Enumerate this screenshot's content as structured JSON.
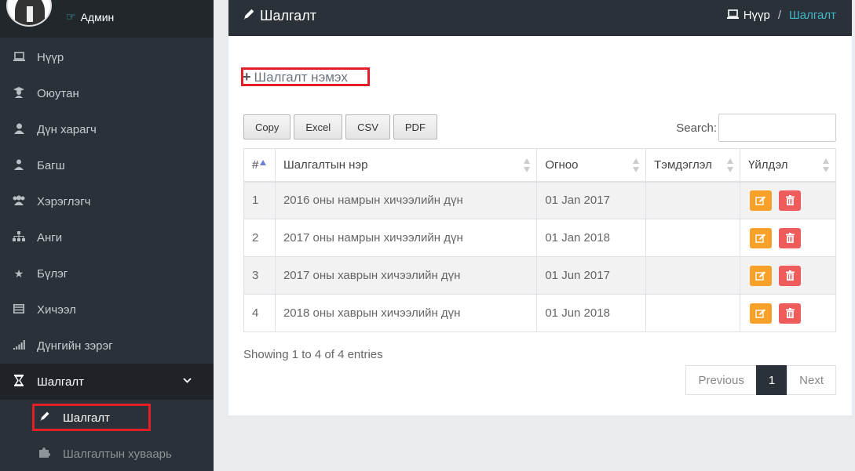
{
  "user": {
    "name": "Админ"
  },
  "sidebar": {
    "items": [
      {
        "label": "Нүүр",
        "icon": "laptop-icon"
      },
      {
        "label": "Оюутан",
        "icon": "graduate-icon"
      },
      {
        "label": "Дүн харагч",
        "icon": "user-icon"
      },
      {
        "label": "Багш",
        "icon": "teacher-icon"
      },
      {
        "label": "Хэрэглэгч",
        "icon": "users-icon"
      },
      {
        "label": "Анги",
        "icon": "sitemap-icon"
      },
      {
        "label": "Бүлэг",
        "icon": "star-icon"
      },
      {
        "label": "Хичээл",
        "icon": "book-icon"
      },
      {
        "label": "Дүнгийн зэрэг",
        "icon": "signal-icon"
      },
      {
        "label": "Шалгалт",
        "icon": "hourglass-icon"
      }
    ],
    "submenu": [
      {
        "label": "Шалгалт",
        "icon": "pencil-icon"
      },
      {
        "label": "Шалгалтын хуваарь",
        "icon": "puzzle-icon"
      }
    ]
  },
  "header": {
    "title": "Шалгалт",
    "breadcrumb_home": "Нүүр",
    "breadcrumb_sep": "/",
    "breadcrumb_current": "Шалгалт"
  },
  "main": {
    "add_label": "Шалгалт нэмэх",
    "buttons": [
      "Copy",
      "Excel",
      "CSV",
      "PDF"
    ],
    "search_label": "Search:",
    "table": {
      "columns": [
        "#",
        "Шалгалтын нэр",
        "Огноо",
        "Тэмдэглэл",
        "Үйлдэл"
      ],
      "rows": [
        [
          "1",
          "2016 оны намрын хичээлийн дүн",
          "01 Jan 2017",
          ""
        ],
        [
          "2",
          "2017 оны намрын хичээлийн дүн",
          "01 Jan 2018",
          ""
        ],
        [
          "3",
          "2017 оны хаврын хичээлийн дүн",
          "01 Jun 2017",
          ""
        ],
        [
          "4",
          "2018 оны хаврын хичээлийн дүн",
          "01 Jun 2018",
          ""
        ]
      ]
    },
    "info": "Showing 1 to 4 of 4 entries",
    "pagination": {
      "previous": "Previous",
      "current": "1",
      "next": "Next"
    }
  },
  "colors": {
    "sidebar_bg": "#2b3138",
    "accent": "#3fb8c8",
    "edit_button": "#f7a12b",
    "delete_button": "#ef5c5c",
    "highlight_box": "#e41e26"
  }
}
